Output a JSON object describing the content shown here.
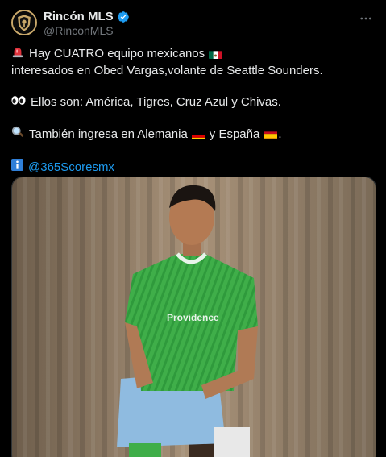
{
  "author": {
    "display_name": "Rincón MLS",
    "handle": "@RinconMLS",
    "avatar_icon": "rincon-mls-logo",
    "verified_icon": "verified-badge-icon",
    "verified_color": "#1d9bf0"
  },
  "more_icon": "more-horizontal-icon",
  "tweet": {
    "line1_text_a": "Hay CUATRO equipo mexicanos",
    "line1_text_b": "interesados en Obed Vargas,",
    "line1_text_c": "volante de Seattle Sounders.",
    "line2_text": "Ellos son: América, Tigres, Cruz Azul y Chivas.",
    "line3_text_a": "También ingresa en Alemania",
    "line3_text_b": "y España",
    "line3_text_c": ".",
    "mention": "@365Scoresmx"
  },
  "icons": {
    "siren": "rotating-light-emoji",
    "flag_mexico": "mexico-flag-emoji",
    "eyes": "eyes-emoji",
    "magnifier": "magnifying-glass-emoji",
    "flag_germany": "germany-flag-emoji",
    "flag_spain": "spain-flag-emoji",
    "info": "information-emoji"
  },
  "media": {
    "description_icon": "player-photo",
    "jersey_sponsor": "Providence"
  },
  "colors": {
    "background": "#000000",
    "text": "#e7e9ea",
    "secondary_text": "#71767b",
    "link": "#1d9bf0",
    "jersey_green": "#3fae49"
  }
}
